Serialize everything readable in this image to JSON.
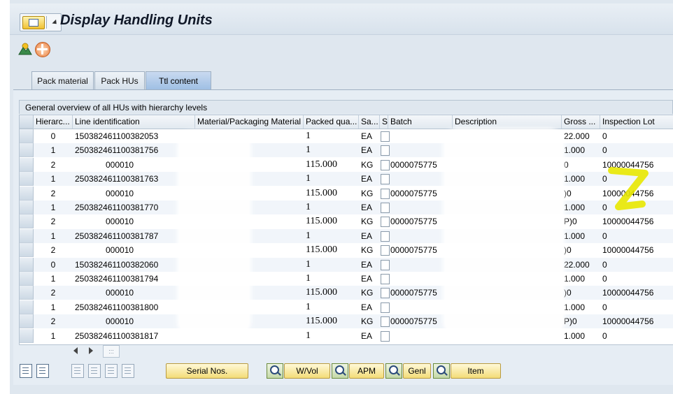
{
  "window": {
    "title": "Display Handling Units"
  },
  "tabs": [
    {
      "label": "Pack material",
      "active": false
    },
    {
      "label": "Pack HUs",
      "active": false
    },
    {
      "label": "Ttl content",
      "active": true
    }
  ],
  "grid": {
    "title": "General overview of all HUs with hierarchy levels",
    "columns": [
      "Hierarc...",
      "Line identification",
      "Material/Packaging Material",
      "Packed qua...",
      "Sa...",
      "S",
      "Batch",
      "Description",
      "Gross ...",
      "Inspection Lot"
    ],
    "rows": [
      {
        "level": "0",
        "line": "150382461100382053",
        "qty": "1",
        "unit": "EA",
        "batch": "",
        "gross": "22.000",
        "lot": "0"
      },
      {
        "level": "1",
        "line": "250382461100381756",
        "qty": "1",
        "unit": "EA",
        "batch": "",
        "gross": "1.000",
        "lot": "0"
      },
      {
        "level": "2",
        "line": "000010",
        "qty": "115.000",
        "unit": "KG",
        "batch": "0000075775",
        "gross": "0",
        "lot": "10000044756"
      },
      {
        "level": "1",
        "line": "250382461100381763",
        "qty": "1",
        "unit": "EA",
        "batch": "",
        "gross": "1.000",
        "lot": "0"
      },
      {
        "level": "2",
        "line": "000010",
        "qty": "115.000",
        "unit": "KG",
        "batch": "0000075775",
        "gross": ")0",
        "lot": "10000044756"
      },
      {
        "level": "1",
        "line": "250382461100381770",
        "qty": "1",
        "unit": "EA",
        "batch": "",
        "gross": "1.000",
        "lot": "0"
      },
      {
        "level": "2",
        "line": "000010",
        "qty": "115.000",
        "unit": "KG",
        "batch": "0000075775",
        "gross": "P)0",
        "lot": "10000044756"
      },
      {
        "level": "1",
        "line": "250382461100381787",
        "qty": "1",
        "unit": "EA",
        "batch": "",
        "gross": "1.000",
        "lot": "0"
      },
      {
        "level": "2",
        "line": "000010",
        "qty": "115.000",
        "unit": "KG",
        "batch": "0000075775",
        "gross": ")0",
        "lot": "10000044756"
      },
      {
        "level": "0",
        "line": "150382461100382060",
        "qty": "1",
        "unit": "EA",
        "batch": "",
        "gross": "22.000",
        "lot": "0"
      },
      {
        "level": "1",
        "line": "250382461100381794",
        "qty": "1",
        "unit": "EA",
        "batch": "",
        "gross": "1.000",
        "lot": "0"
      },
      {
        "level": "2",
        "line": "000010",
        "qty": "115.000",
        "unit": "KG",
        "batch": "0000075775",
        "gross": ")0",
        "lot": "10000044756"
      },
      {
        "level": "1",
        "line": "250382461100381800",
        "qty": "1",
        "unit": "EA",
        "batch": "",
        "gross": "1.000",
        "lot": "0"
      },
      {
        "level": "2",
        "line": "000010",
        "qty": "115.000",
        "unit": "KG",
        "batch": "0000075775",
        "gross": "P)0",
        "lot": "10000044756"
      },
      {
        "level": "1",
        "line": "250382461100381817",
        "qty": "1",
        "unit": "EA",
        "batch": "",
        "gross": "1.000",
        "lot": "0"
      }
    ]
  },
  "toolbar": {
    "serial_label": "Serial Nos.",
    "wvol_label": "W/Vol",
    "apm_label": "APM",
    "genl_label": "Genl",
    "item_label": "Item"
  },
  "colors": {
    "accent": "#9fbfe4",
    "button": "#f3dc78",
    "highlight": "#e8e800"
  }
}
